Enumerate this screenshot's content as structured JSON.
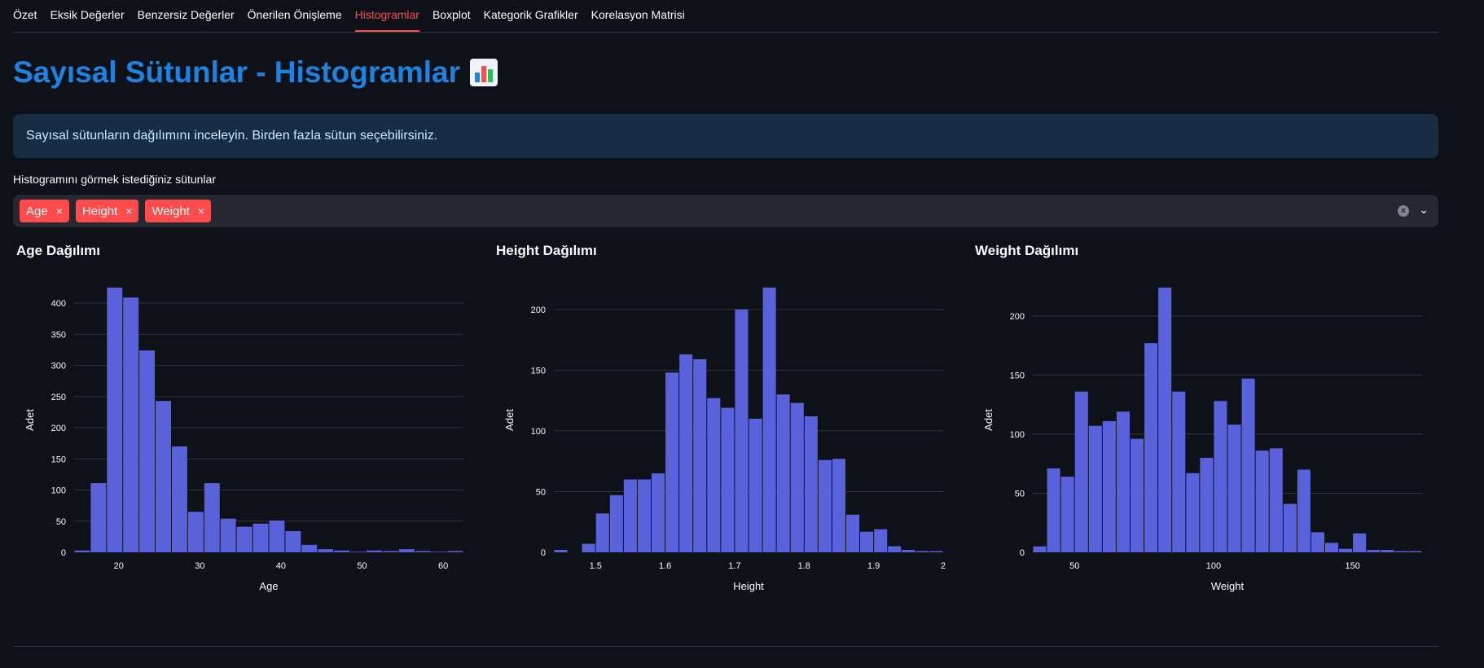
{
  "tabs": [
    "Özet",
    "Eksik Değerler",
    "Benzersiz Değerler",
    "Önerilen Önişleme",
    "Histogramlar",
    "Boxplot",
    "Kategorik Grafikler",
    "Korelasyon Matrisi"
  ],
  "active_tab": "Histogramlar",
  "page_title": "Sayısal Sütunlar - Histogramlar",
  "title_icon": "bar-chart-icon",
  "info_text": "Sayısal sütunların dağılımını inceleyin. Birden fazla sütun seçebilirsiniz.",
  "multiselect": {
    "label": "Histogramını görmek istediğiniz sütunlar",
    "selected": [
      "Age",
      "Height",
      "Weight"
    ],
    "remove_glyph": "×",
    "clear_glyph": "×",
    "chevron_glyph": "⌄"
  },
  "colors": {
    "accent": "#ff4b4b",
    "bar": "#5a62db",
    "title": "#1c83e1",
    "info_bg": "#172d43",
    "grid": "#31333f"
  },
  "chart_data": [
    {
      "type": "bar",
      "title": "Age Dağılımı",
      "xlabel": "Age",
      "ylabel": "Adet",
      "bin_start": 14.5,
      "bin_width": 2,
      "values": [
        3,
        111,
        425,
        409,
        324,
        243,
        170,
        65,
        111,
        54,
        41,
        46,
        51,
        34,
        12,
        5,
        3,
        1,
        3,
        2,
        5,
        2,
        1,
        2
      ],
      "xlim": [
        14.5,
        62.5
      ],
      "ylim": [
        0,
        425
      ],
      "xticks": [
        20,
        30,
        40,
        50,
        60
      ],
      "yticks": [
        0,
        50,
        100,
        150,
        200,
        250,
        300,
        350,
        400
      ]
    },
    {
      "type": "bar",
      "title": "Height Dağılımı",
      "xlabel": "Height",
      "ylabel": "Adet",
      "bin_start": 1.44,
      "bin_width": 0.02,
      "values": [
        2,
        0,
        7,
        32,
        47,
        60,
        60,
        65,
        148,
        163,
        159,
        127,
        119,
        200,
        110,
        218,
        130,
        123,
        112,
        76,
        77,
        31,
        17,
        19,
        5,
        2,
        1,
        1
      ],
      "xlim": [
        1.44,
        2.0
      ],
      "ylim": [
        0,
        218
      ],
      "xticks": [
        1.5,
        1.6,
        1.7,
        1.8,
        1.9,
        2
      ],
      "yticks": [
        0,
        50,
        100,
        150,
        200
      ]
    },
    {
      "type": "bar",
      "title": "Weight Dağılımı",
      "xlabel": "Weight",
      "ylabel": "Adet",
      "bin_start": 35,
      "bin_width": 5,
      "values": [
        5,
        71,
        64,
        136,
        107,
        111,
        119,
        96,
        177,
        224,
        136,
        67,
        80,
        128,
        108,
        147,
        86,
        88,
        41,
        70,
        17,
        8,
        3,
        16,
        2,
        2,
        1,
        1
      ],
      "xlim": [
        35,
        175
      ],
      "ylim": [
        0,
        224
      ],
      "xticks": [
        50,
        100,
        150
      ],
      "yticks": [
        0,
        50,
        100,
        150,
        200
      ]
    }
  ]
}
